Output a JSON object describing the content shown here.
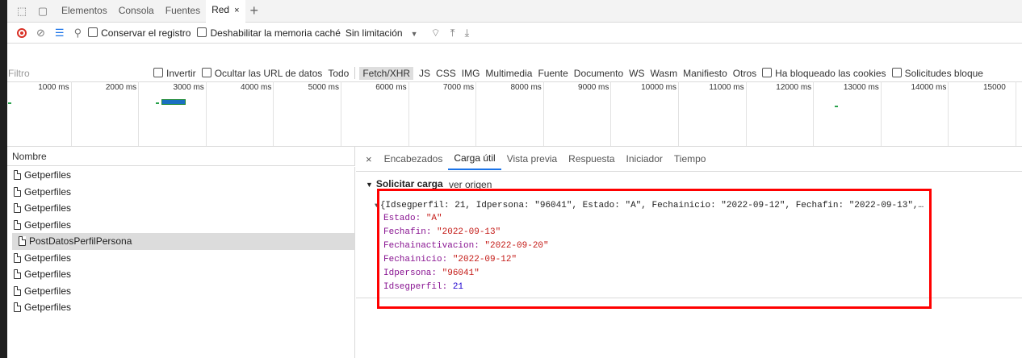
{
  "tabs": {
    "items": [
      {
        "label": "Elementos"
      },
      {
        "label": "Consola"
      },
      {
        "label": "Fuentes"
      },
      {
        "label": "Red"
      }
    ],
    "close_glyph": "×",
    "add_glyph": "+"
  },
  "toolbar": {
    "preserve_log": "Conservar el registro",
    "disable_cache": "Deshabilitar la memoria caché",
    "throttling": "Sin limitación"
  },
  "filter": {
    "placeholder": "Filtro",
    "invert": "Invertir",
    "hide_data_urls": "Ocultar las URL de datos",
    "types": [
      "Todo",
      "Fetch/XHR",
      "JS",
      "CSS",
      "IMG",
      "Multimedia",
      "Fuente",
      "Documento",
      "WS",
      "Wasm",
      "Manifiesto",
      "Otros"
    ],
    "active_type": "Fetch/XHR",
    "blocked_cookies": "Ha bloqueado las cookies",
    "blocked_requests": "Solicitudes bloque"
  },
  "timeline": {
    "ticks": [
      "1000 ms",
      "2000 ms",
      "3000 ms",
      "4000 ms",
      "5000 ms",
      "6000 ms",
      "7000 ms",
      "8000 ms",
      "9000 ms",
      "10000 ms",
      "11000 ms",
      "12000 ms",
      "13000 ms",
      "14000 ms",
      "15000"
    ]
  },
  "list": {
    "header": "Nombre",
    "rows": [
      {
        "name": "Getperfiles"
      },
      {
        "name": "Getperfiles"
      },
      {
        "name": "Getperfiles"
      },
      {
        "name": "Getperfiles"
      },
      {
        "name": "PostDatosPerfilPersona",
        "selected": true
      },
      {
        "name": "Getperfiles"
      },
      {
        "name": "Getperfiles"
      },
      {
        "name": "Getperfiles"
      },
      {
        "name": "Getperfiles"
      }
    ]
  },
  "detail": {
    "close_glyph": "×",
    "tabs": [
      "Encabezados",
      "Carga útil",
      "Vista previa",
      "Respuesta",
      "Iniciador",
      "Tiempo"
    ],
    "active_tab": "Carga útil",
    "section_title": "Solicitar carga",
    "view_source": "ver origen",
    "summary": "{Idsegperfil: 21, Idpersona: \"96041\", Estado: \"A\", Fechainicio: \"2022-09-12\", Fechafin: \"2022-09-13\",…",
    "properties": [
      {
        "key": "Estado",
        "value": "\"A\"",
        "kind": "string"
      },
      {
        "key": "Fechafin",
        "value": "\"2022-09-13\"",
        "kind": "string"
      },
      {
        "key": "Fechainactivacion",
        "value": "\"2022-09-20\"",
        "kind": "string"
      },
      {
        "key": "Fechainicio",
        "value": "\"2022-09-12\"",
        "kind": "string"
      },
      {
        "key": "Idpersona",
        "value": "\"96041\"",
        "kind": "string"
      },
      {
        "key": "Idsegperfil",
        "value": "21",
        "kind": "number"
      }
    ]
  },
  "colors": {
    "record": "#d93025",
    "highlight_box": "#ff0000",
    "active_tab_underline": "#1a73e8",
    "json_key": "#881391",
    "json_string": "#c41a16",
    "json_number": "#1c00cf"
  },
  "icons": [
    "inspect-icon",
    "device-icon",
    "record-icon",
    "clear-icon",
    "filter-icon",
    "search-icon",
    "wifi-icon",
    "upload-icon",
    "download-icon",
    "document-icon"
  ]
}
